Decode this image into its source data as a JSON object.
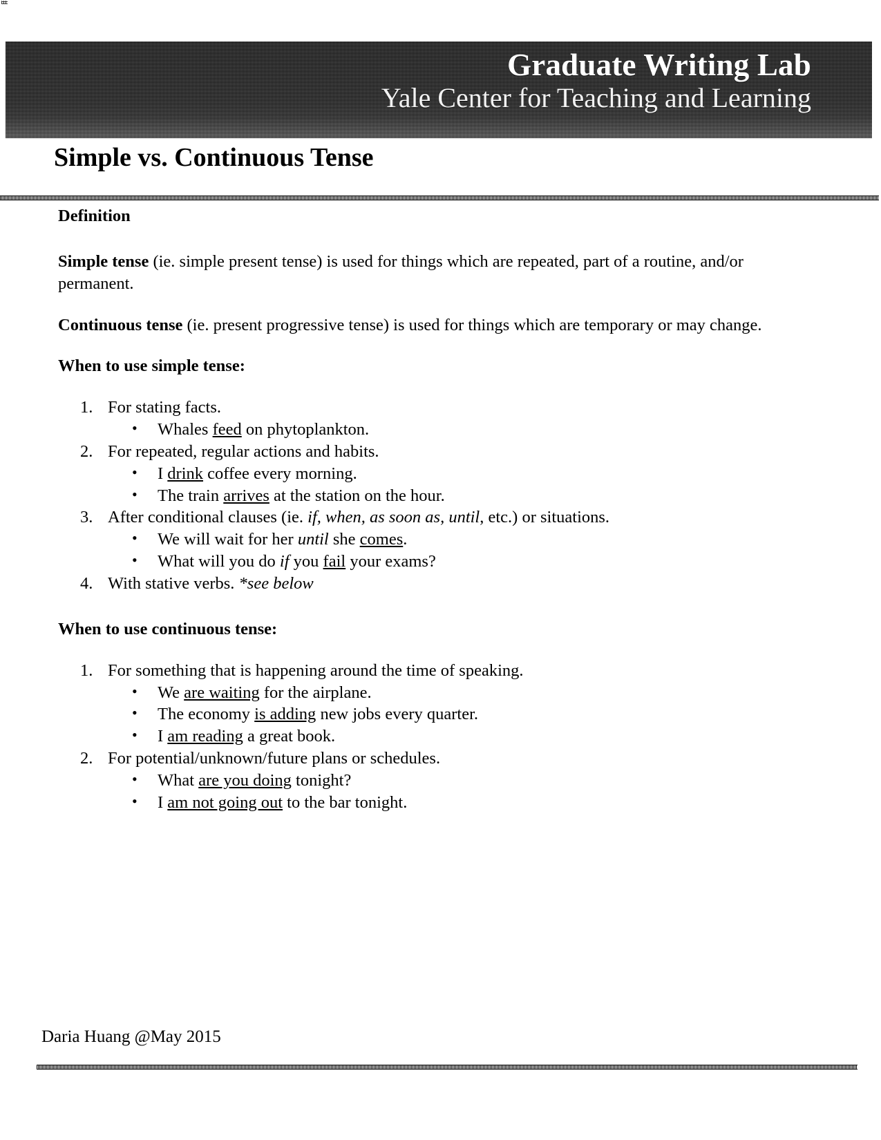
{
  "header": {
    "brand_title": "Graduate Writing Lab",
    "brand_subtitle": "Yale Center for Teaching and Learning",
    "band_color": "#3a3a3a",
    "text_color": "#ffffff"
  },
  "document": {
    "title": "Simple vs. Continuous Tense"
  },
  "body": {
    "definition_heading": "Definition",
    "definition_simple": {
      "term": "Simple tense",
      "rest": " (ie. simple present tense) is used for things which are repeated, part of a routine, and/or permanent."
    },
    "definition_continuous": {
      "term": "Continuous tense",
      "rest": " (ie. present progressive tense) is used for things which are temporary or may change."
    },
    "simple_section": {
      "heading": "When to use simple tense:",
      "items": [
        {
          "number": "1.",
          "text": "For stating facts.",
          "bullets": [
            {
              "marker": "•",
              "pre": "Whales ",
              "underline": "feed",
              "post": " on phytoplankton."
            }
          ]
        },
        {
          "number": "2.",
          "text": "For repeated, regular actions and habits.",
          "bullets": [
            {
              "marker": "•",
              "pre": "I ",
              "underline": "drink",
              "post": " coffee every morning."
            },
            {
              "marker": "•",
              "pre": "The train ",
              "underline": "arrives",
              "post": " at the station on the hour."
            }
          ]
        },
        {
          "number": "3.",
          "text_pre": "After conditional clauses (ie. ",
          "text_italic": "if, when, as soon as, until",
          "text_post": ", etc.) or situations.",
          "bullets": [
            {
              "marker": "•",
              "pre": "We will wait for her ",
              "italic": "until",
              "mid": " she ",
              "underline": "comes",
              "post": "."
            },
            {
              "marker": "•",
              "pre": "What will you do ",
              "italic": "if",
              "mid": " you ",
              "underline": "fail",
              "post": " your exams?"
            }
          ]
        },
        {
          "number": "4.",
          "text_pre": "With stative verbs. ",
          "text_italic": "*see below",
          "bullets": []
        }
      ]
    },
    "continuous_section": {
      "heading": "When to use continuous tense:",
      "items": [
        {
          "number": "1.",
          "text": "For something that is happening around the time of speaking.",
          "bullets": [
            {
              "marker": "•",
              "pre": "We ",
              "underline": "are waiting",
              "post": " for the airplane."
            },
            {
              "marker": "•",
              "pre": "The economy ",
              "underline": "is adding",
              "post": " new jobs every quarter."
            },
            {
              "marker": "•",
              "pre": "I ",
              "underline": "am reading",
              "post": " a great book."
            }
          ]
        },
        {
          "number": "2.",
          "text": "For potential/unknown/future plans or schedules.",
          "bullets": [
            {
              "marker": "•",
              "pre": "What ",
              "underline": "are you doing",
              "post": " tonight?"
            },
            {
              "marker": "•",
              "pre": "I ",
              "underline": "am not going out",
              "post": " to the bar tonight."
            }
          ]
        }
      ]
    }
  },
  "footer": {
    "credit": "Daria Huang @May 2015"
  }
}
